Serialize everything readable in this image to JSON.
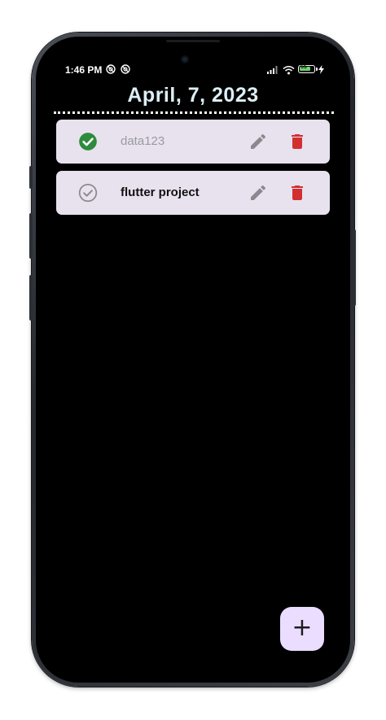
{
  "status_bar": {
    "time": "1:46 PM",
    "battery_level": "55",
    "icons": [
      "notification-icon",
      "notification-icon",
      "signal-icon",
      "wifi-icon",
      "battery-icon",
      "charging-icon"
    ]
  },
  "header": {
    "title": "April, 7,  2023"
  },
  "tasks": [
    {
      "label": "data123",
      "completed": true
    },
    {
      "label": "flutter project",
      "completed": false
    }
  ],
  "colors": {
    "completed_check": "#2e8b3d",
    "uncompleted_check": "#8a8a8e",
    "delete": "#d32f2f",
    "edit": "#8a8a8e",
    "card_bg": "#e8e2ef",
    "fab_bg": "#eaddff",
    "title": "#dceef5"
  },
  "fab": {
    "label": "+"
  }
}
